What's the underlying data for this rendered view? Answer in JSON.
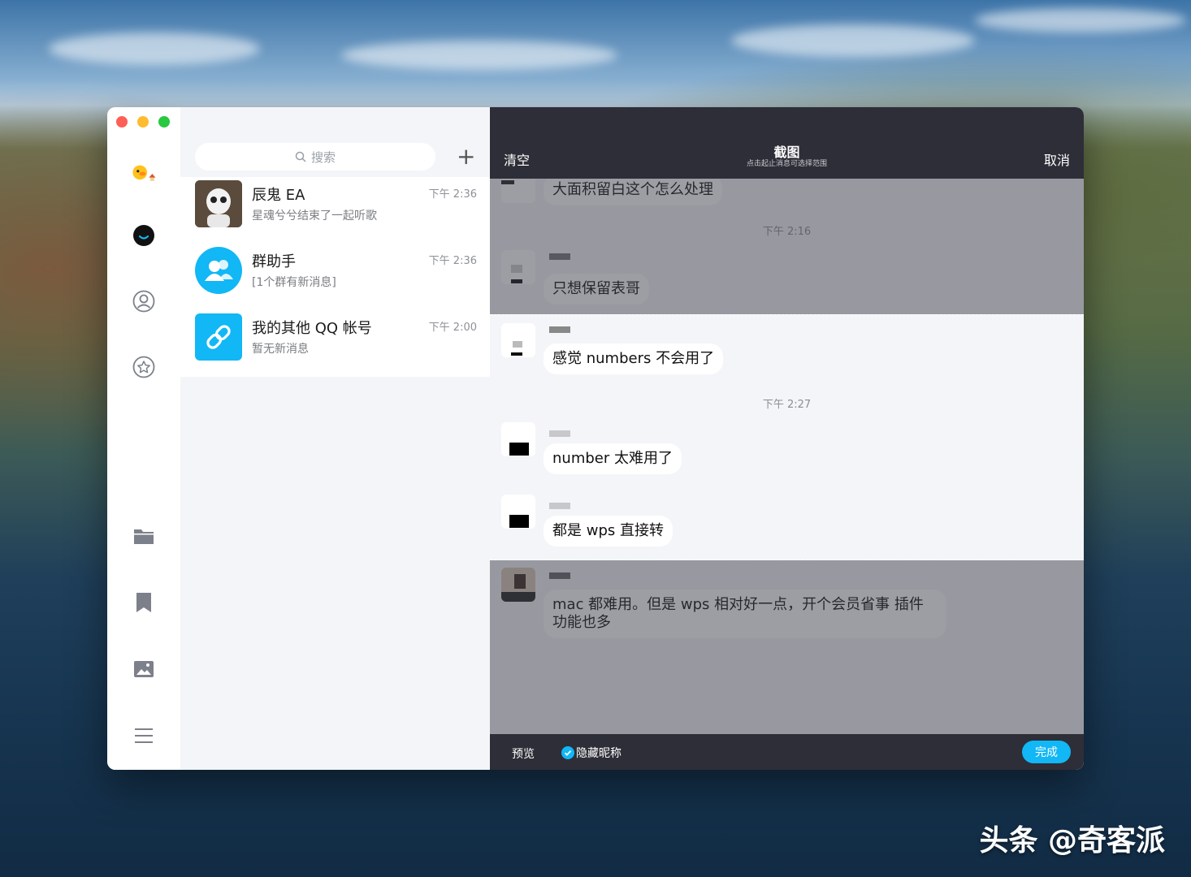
{
  "sidebar": {
    "icons": [
      "pet-avatar-icon",
      "chat-icon",
      "contacts-icon",
      "star-icon",
      "folder-icon",
      "bookmark-icon",
      "image-icon",
      "menu-icon"
    ]
  },
  "chat_list": {
    "search_placeholder": "搜索",
    "add_label": "+",
    "conversations": [
      {
        "name": "辰鬼 EA",
        "preview": "星魂兮兮结束了一起听歌",
        "time": "下午 2:36"
      },
      {
        "name": "群助手",
        "preview": "[1个群有新消息]",
        "time": "下午 2:36"
      },
      {
        "name": "我的其他 QQ 帐号",
        "preview": "暂无新消息",
        "time": "下午 2:00"
      }
    ]
  },
  "screenshot_panel": {
    "clear_label": "清空",
    "title": "截图",
    "subtitle": "点击起止消息可选择范围",
    "cancel_label": "取消",
    "messages": [
      {
        "text": "大面积留白这个怎么处理"
      },
      {
        "timestamp": "下午 2:16"
      },
      {
        "text": "只想保留表哥"
      },
      {
        "text": "感觉 numbers 不会用了"
      },
      {
        "timestamp": "下午 2:27"
      },
      {
        "text": "number 太难用了"
      },
      {
        "text": "都是 wps 直接转"
      },
      {
        "text": "mac 都难用。但是 wps 相对好一点，开个会员省事 插件功能也多"
      }
    ],
    "footer": {
      "preview_label": "预览",
      "hide_nick_label": "隐藏昵称",
      "done_label": "完成"
    }
  },
  "watermark": "头条 @奇客派",
  "colors": {
    "accent": "#12b7f5",
    "header": "#2e2e38"
  }
}
